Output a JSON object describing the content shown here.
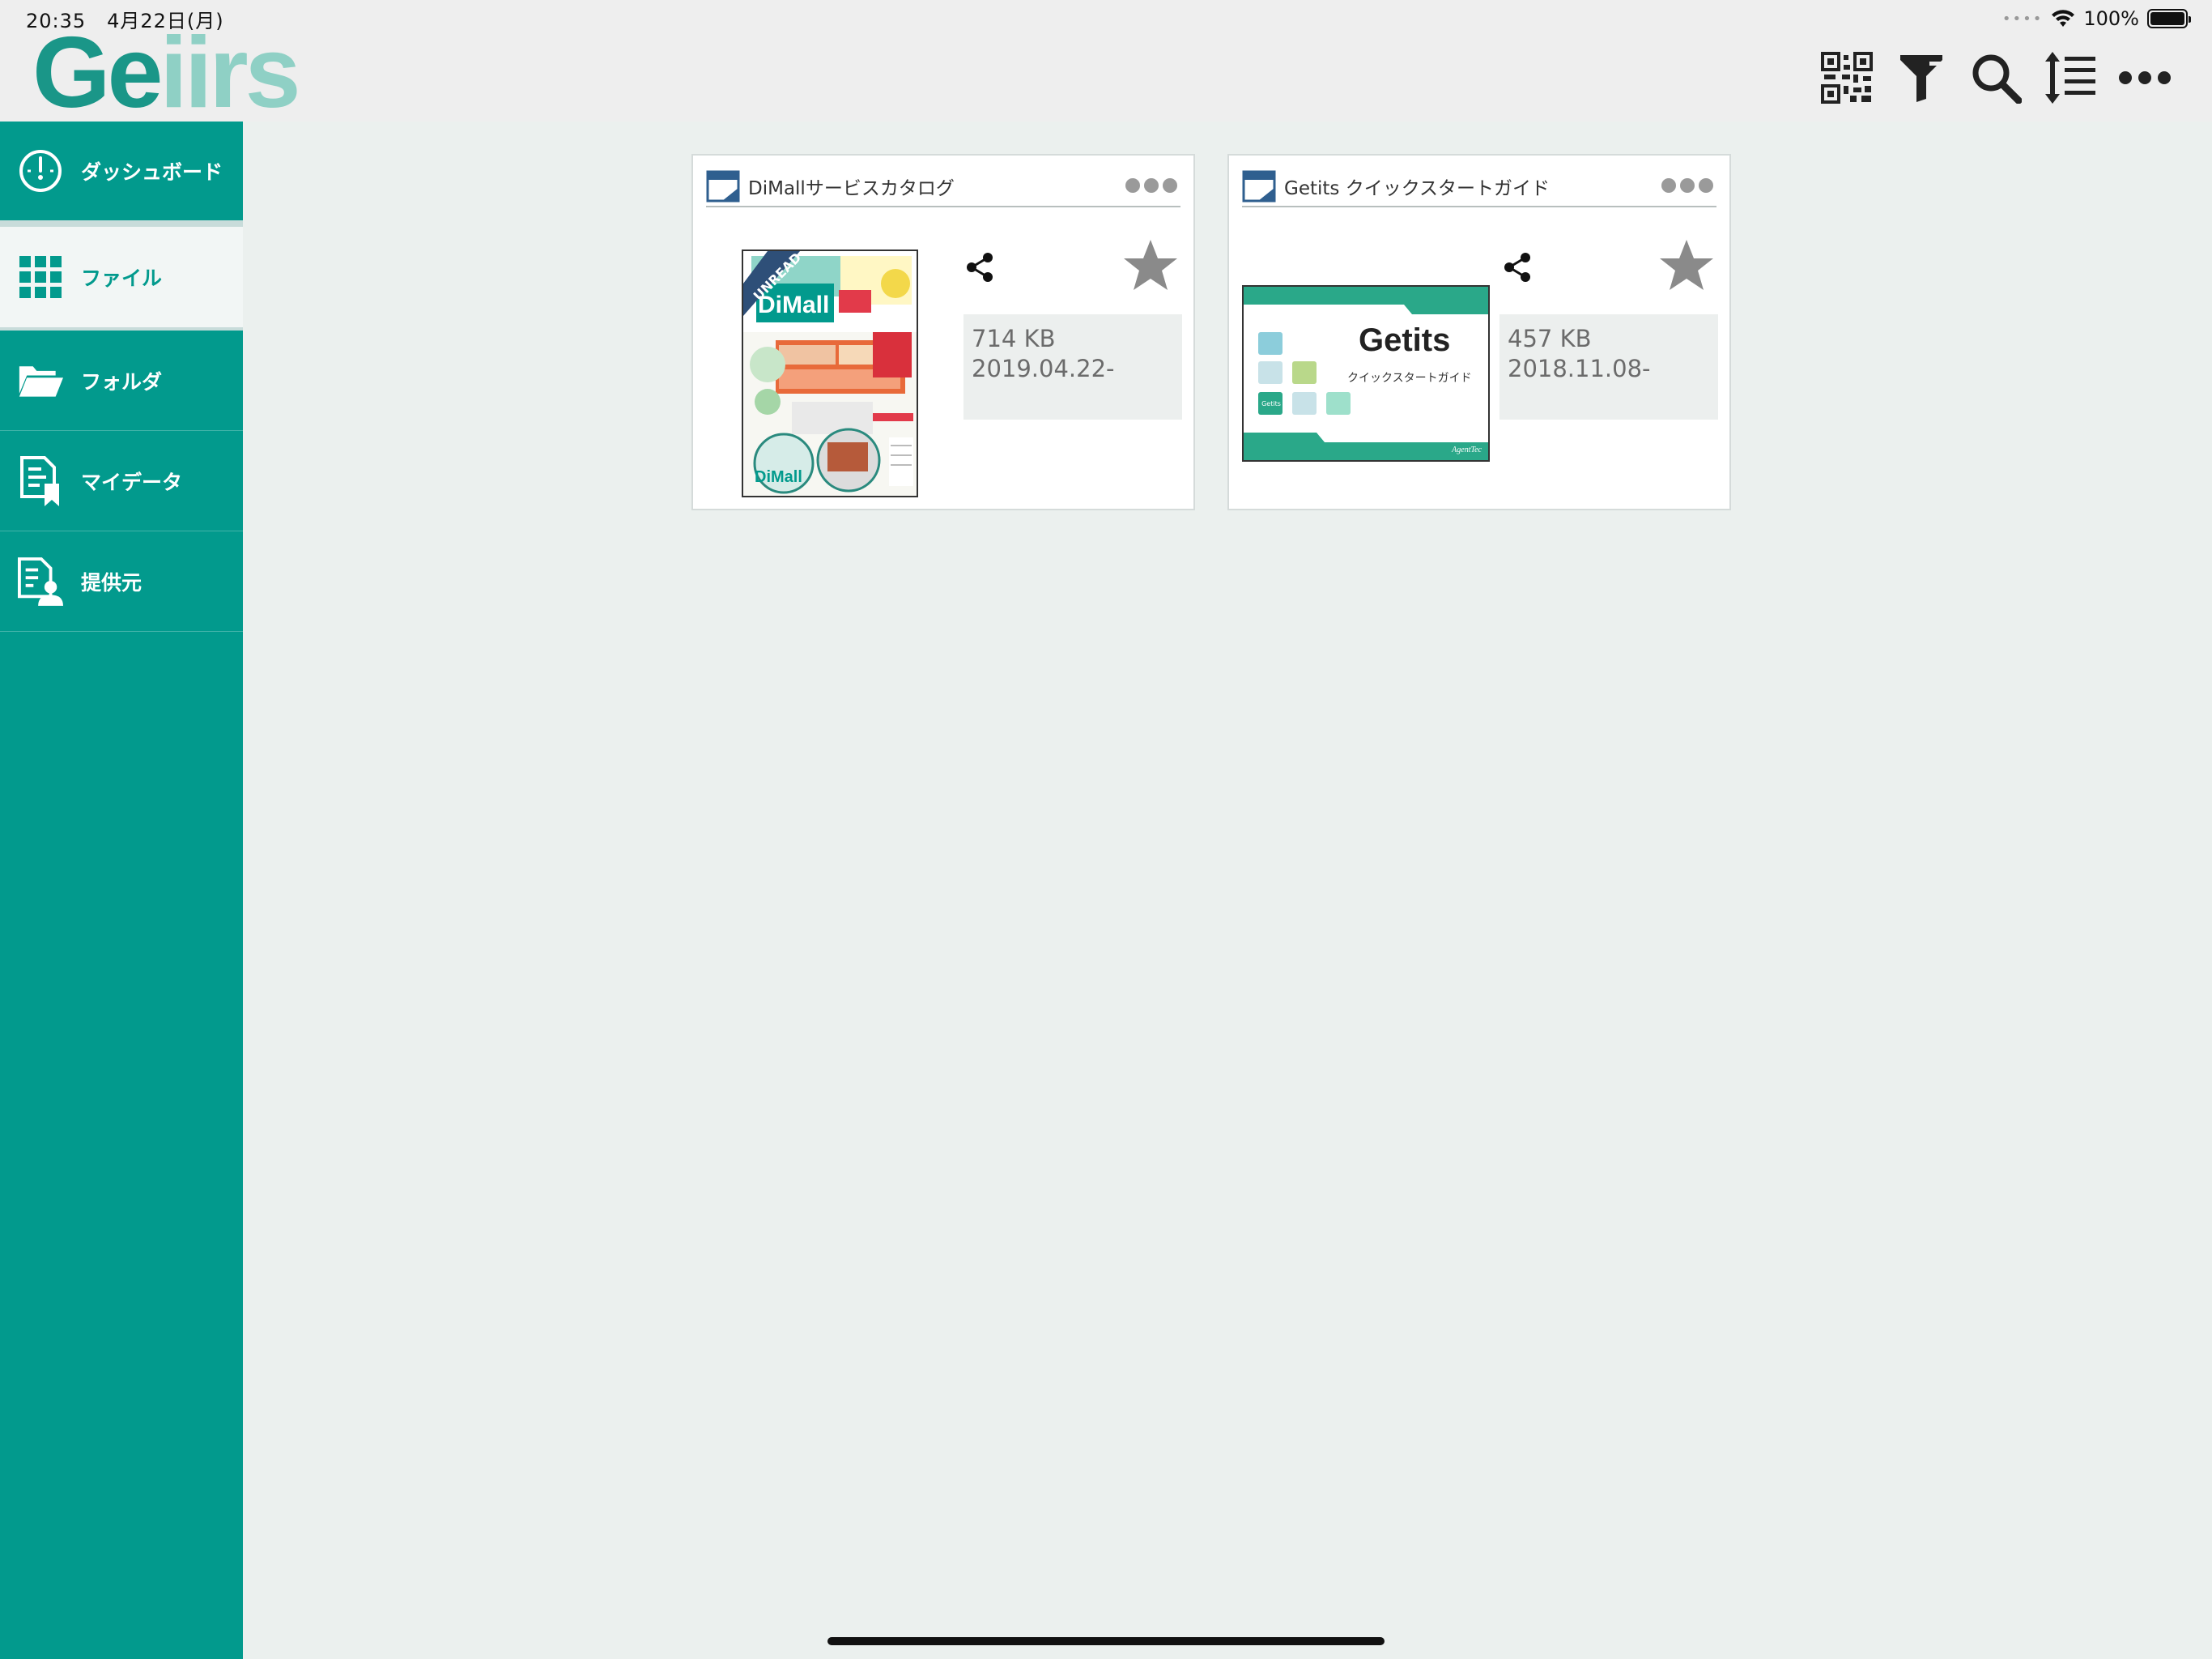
{
  "status_bar": {
    "time": "20:35",
    "date": "4月22日(月)",
    "signal_dots": "••••",
    "battery": "100%"
  },
  "header": {
    "logo_dark": "Ge",
    "logo_light": "iirs",
    "toolbar_icons": [
      "qr-code-icon",
      "filter-icon",
      "search-icon",
      "sort-icon",
      "more-icon"
    ]
  },
  "sidebar": {
    "items": [
      {
        "label": "ダッシュボード",
        "icon": "dashboard-icon"
      },
      {
        "label": "ファイル",
        "icon": "grid-icon"
      },
      {
        "label": "フォルダ",
        "icon": "folder-icon"
      },
      {
        "label": "マイデータ",
        "icon": "document-bookmark-icon"
      },
      {
        "label": "提供元",
        "icon": "document-user-icon"
      }
    ]
  },
  "files": [
    {
      "title": "DiMallサービスカタログ",
      "size": "714 KB",
      "date": "2019.04.22-",
      "badge": "UNREAD",
      "thumb_brand": "DiMall"
    },
    {
      "title": "Getits クイックスタートガイド",
      "size": "457 KB",
      "date": "2018.11.08-",
      "thumb_brand": "Getits",
      "thumb_subtitle": "クイックスタートガイド",
      "thumb_tag": "Getits",
      "thumb_footer": "AgentTec"
    }
  ],
  "colors": {
    "accent": "#029a8d",
    "logo_light": "#8fd0c5",
    "background": "#ebf0ee"
  }
}
